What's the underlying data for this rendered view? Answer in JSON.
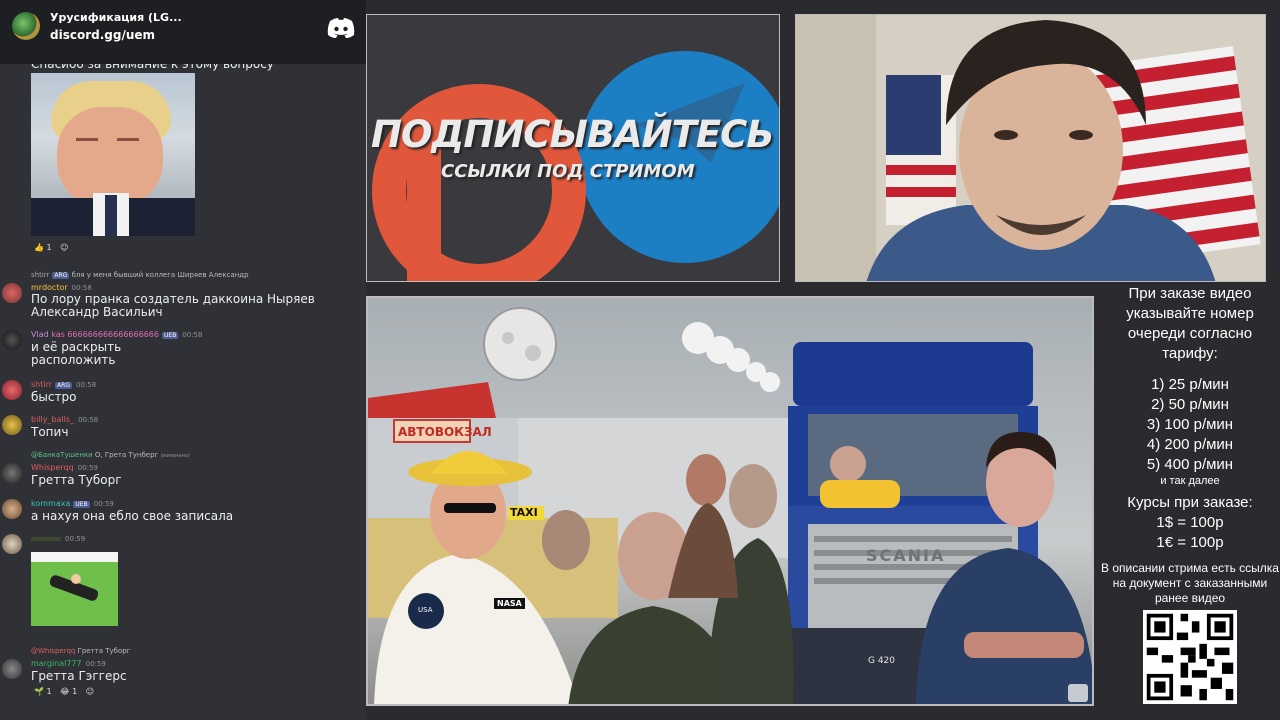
{
  "server": {
    "name": "Урусификация (LG...",
    "link": "discord.gg/uem"
  },
  "chat": {
    "top_text": "Спасибо за внимание к этому вопросу",
    "reactions1": [
      "1"
    ],
    "reply1": {
      "user": "shtirr",
      "tag": "ARG",
      "text": "бля у меня бывший коллега Ширяев Александр"
    },
    "msg1": {
      "user": "mrdoctor",
      "time": "00:58",
      "line1": "По лору пранка создатель даккоина Ныряев",
      "line2": "Александр Васильич"
    },
    "msg2": {
      "user": "Vlad",
      "extra": "kas 666666666666666666",
      "tag": "UEB",
      "time": "00:58",
      "line1": "и её раскрыть",
      "line2": "расположить"
    },
    "msg3": {
      "user": "shtirr",
      "tag": "ARG",
      "time": "00:58",
      "text": "быстро"
    },
    "msg4": {
      "user": "billy_balls_",
      "time": "00:58",
      "text": "Топич"
    },
    "reply2": {
      "user": "@БанкаТушенки",
      "text": "О, Грета Тунберг",
      "edited": "(изменено)"
    },
    "msg5": {
      "user": "Whisperqq",
      "time": "00:59",
      "text": "Гретта Туборг"
    },
    "msg6": {
      "user": "kommaxa",
      "tag": "UEB",
      "time": "00:59",
      "text": "а нахуя она ебло свое записала"
    },
    "msg7": {
      "time": "00:59"
    },
    "reply3": {
      "user": "@Whisperqq",
      "text": "Гретта Туборг"
    },
    "msg8": {
      "user": "marginal777",
      "time": "00:59",
      "text": "Гретта Гэггерс"
    },
    "reactions2": [
      "1",
      "1"
    ]
  },
  "subscribe": {
    "title": "ПОДПИСЫВАЙТЕСЬ",
    "subtitle": "ССЫЛКИ ПОД СТРИМОМ"
  },
  "poster": {
    "station": "АВТОВОКЗАЛ",
    "taxi": "TAXI",
    "brand": "SCANIA",
    "model": "G 420",
    "nasa": "NASA",
    "usa": "USA"
  },
  "info": {
    "intro": "При заказе видео указывайте номер очереди согласно тарифу:",
    "tariffs": [
      "1) 25 р/мин",
      "2) 50 р/мин",
      "3) 100 р/мин",
      "4) 200 р/мин",
      "5) 400 р/мин"
    ],
    "etc": "и так далее",
    "rates_title": "Курсы при заказе:",
    "rates": [
      "1$ = 100р",
      "1€ = 100р"
    ],
    "desc": "В описании стрима есть ссылка на документ с заказанными ранее видео"
  },
  "colors": {
    "discord_bg": "#2f3136",
    "telegram": "#1c7fc4",
    "patreon": "#e0573b",
    "scania_blue": "#1b3a8f"
  }
}
